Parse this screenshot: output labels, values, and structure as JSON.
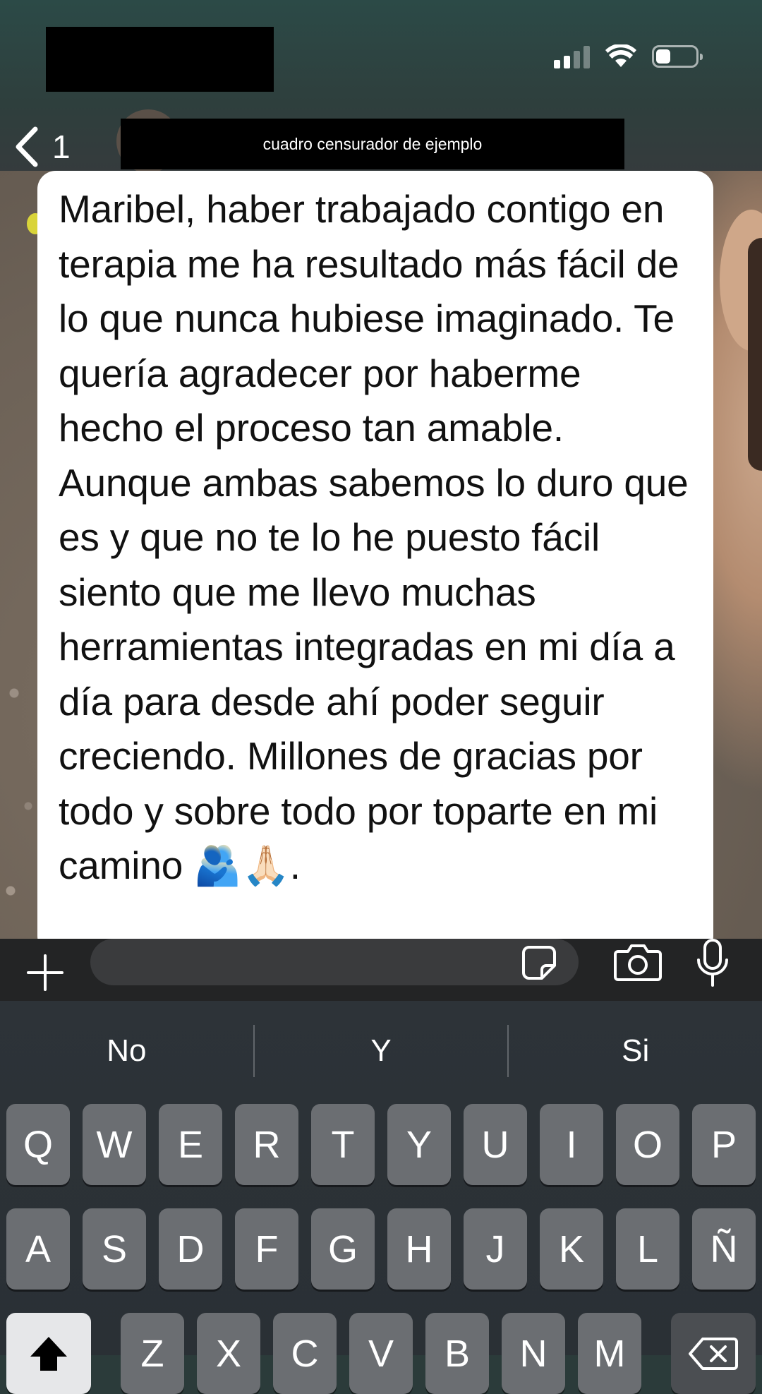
{
  "status_bar": {
    "icons": [
      "signal-icon",
      "wifi-icon",
      "battery-icon"
    ]
  },
  "header": {
    "back_count": "1",
    "censor_label": "cuadro censurador de ejemplo"
  },
  "message": {
    "text": "Maribel, haber trabajado contigo en terapia me ha resultado más fácil de lo que nunca hubiese imaginado. Te quería agradecer por haberme hecho el proceso tan amable. Aunque ambas sabemos lo duro que es y que no te lo he puesto fácil siento que me llevo muchas herramientas integradas en mi día a día para desde ahí poder seguir creciendo. Millones de gracias por todo y sobre todo por toparte en mi camino 🫂🙏🏻."
  },
  "input_bar": {
    "placeholder": "",
    "icons": [
      "plus-icon",
      "sticker-icon",
      "camera-icon",
      "microphone-icon"
    ]
  },
  "keyboard": {
    "suggestions": [
      "No",
      "Y",
      "Si"
    ],
    "row1": [
      "Q",
      "W",
      "E",
      "R",
      "T",
      "Y",
      "U",
      "I",
      "O",
      "P"
    ],
    "row2": [
      "A",
      "S",
      "D",
      "F",
      "G",
      "H",
      "J",
      "K",
      "L",
      "Ñ"
    ],
    "row3": [
      "Z",
      "X",
      "C",
      "V",
      "B",
      "N",
      "M"
    ]
  },
  "colors": {
    "header_bg": "#2e3f3d",
    "bubble_bg": "#ffffff",
    "input_bar_bg": "#232425",
    "keyboard_bg": "#2d3338",
    "key_bg": "#6b6e72",
    "shift_key_bg": "#e6e7e9"
  }
}
